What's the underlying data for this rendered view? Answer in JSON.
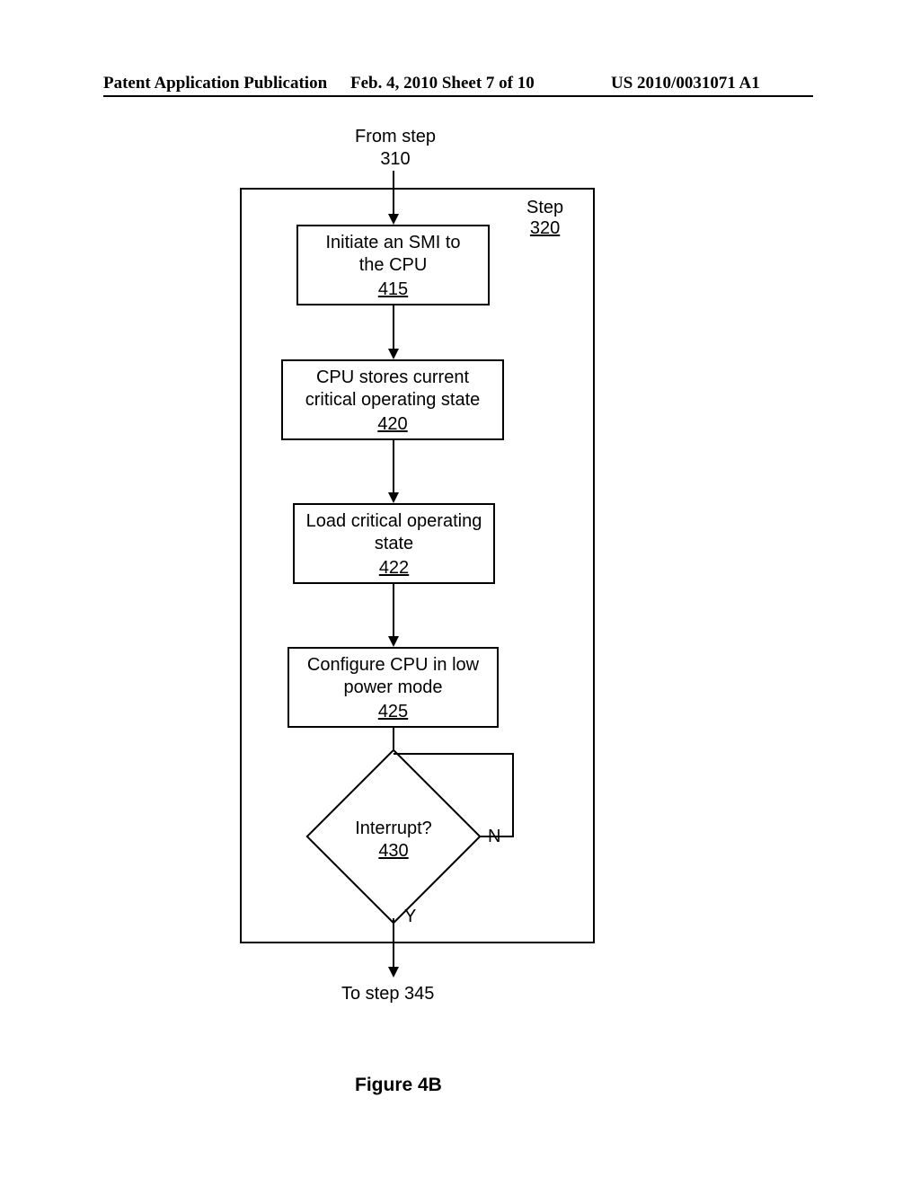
{
  "header": {
    "left": "Patent Application Publication",
    "center": "Feb. 4, 2010  Sheet 7 of 10",
    "right": "US 2010/0031071 A1"
  },
  "labels": {
    "from": "From step\n310",
    "to": "To step 345",
    "stepWord": "Step",
    "stepRef": "320",
    "yes": "Y",
    "no": "N"
  },
  "boxes": {
    "b415": {
      "text": "Initiate an SMI to\nthe CPU",
      "ref": "415"
    },
    "b420": {
      "text": "CPU stores current\ncritical operating state",
      "ref": "420"
    },
    "b422": {
      "text": "Load critical operating\nstate",
      "ref": "422"
    },
    "b425": {
      "text": "Configure CPU in low\npower mode",
      "ref": "425"
    }
  },
  "decision": {
    "text": "Interrupt?",
    "ref": "430"
  },
  "figure": "Figure 4B"
}
